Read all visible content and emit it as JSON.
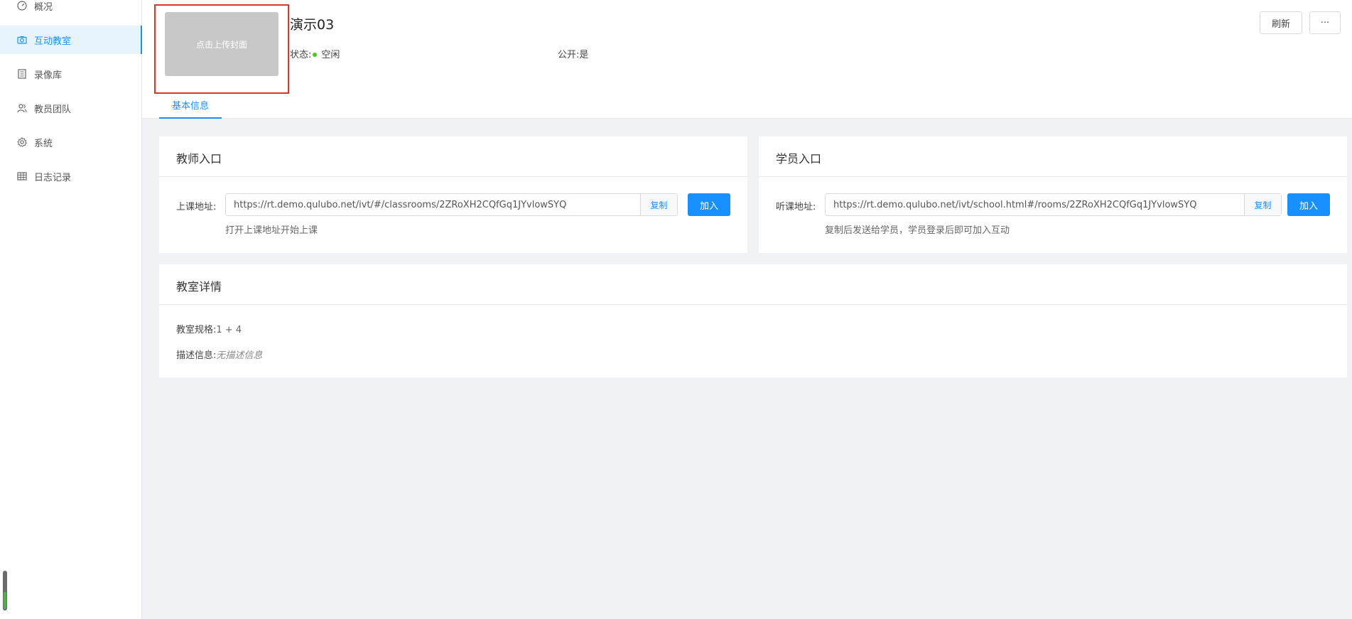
{
  "sidebar": {
    "items": [
      {
        "label": "概况",
        "icon": "dashboard-icon"
      },
      {
        "label": "互动教室",
        "icon": "camera-icon",
        "active": true
      },
      {
        "label": "录像库",
        "icon": "book-icon"
      },
      {
        "label": "教员团队",
        "icon": "team-icon"
      },
      {
        "label": "系统",
        "icon": "gear-icon"
      },
      {
        "label": "日志记录",
        "icon": "table-icon"
      }
    ]
  },
  "header": {
    "cover_label": "点击上传封面",
    "title": "演示03",
    "status_label": "状态:",
    "status_value": "空闲",
    "public_label": "公开:",
    "public_value": "是",
    "refresh_label": "刷新",
    "more_label": "···",
    "tab_label": "基本信息"
  },
  "teacher": {
    "title": "教师入口",
    "field_label": "上课地址:",
    "url": "https://rt.demo.qulubo.net/ivt/#/classrooms/2ZRoXH2CQfGq1JYvlowSYQ",
    "copy_label": "复制",
    "join_label": "加入",
    "hint": "打开上课地址开始上课"
  },
  "student": {
    "title": "学员入口",
    "field_label": "听课地址:",
    "url": "https://rt.demo.qulubo.net/ivt/school.html#/rooms/2ZRoXH2CQfGq1JYvlowSYQ",
    "copy_label": "复制",
    "join_label": "加入",
    "hint": "复制后发送给学员，学员登录后即可加入互动"
  },
  "details": {
    "title": "教室详情",
    "spec_label": "教室规格:",
    "spec_value": "1 + 4",
    "desc_label": "描述信息:",
    "desc_value": "无描述信息"
  },
  "colors": {
    "accent": "#1890ff",
    "status_idle": "#52c41a",
    "highlight_outline": "#e0342b"
  }
}
